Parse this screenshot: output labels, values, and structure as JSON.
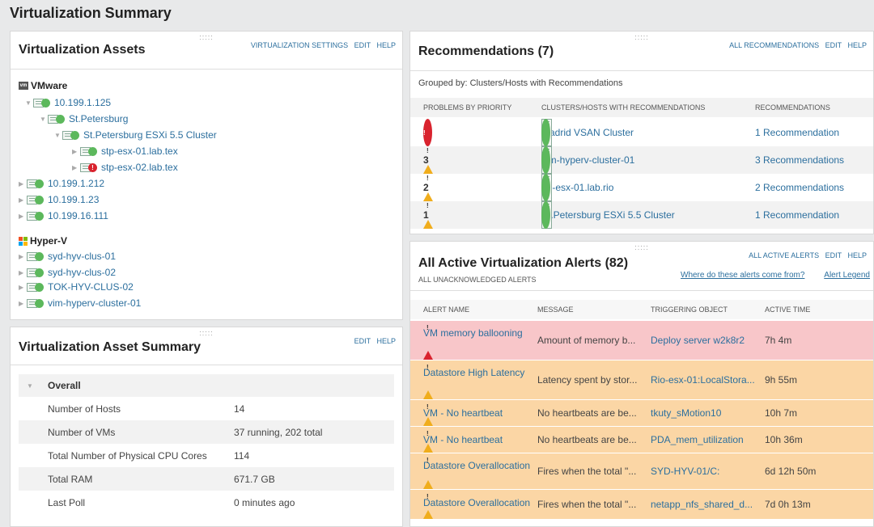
{
  "page_title": "Virtualization Summary",
  "grip": ":::::",
  "assets": {
    "title": "Virtualization Assets",
    "links": [
      "VIRTUALIZATION SETTINGS",
      "EDIT",
      "HELP"
    ],
    "vmware_label": "VMware",
    "hyperv_label": "Hyper-V",
    "vmware_tree": [
      {
        "label": "10.199.1.125",
        "status": "green"
      },
      {
        "label": "St.Petersburg",
        "status": "green"
      },
      {
        "label": "St.Petersburg ESXi 5.5 Cluster",
        "status": "green"
      },
      {
        "label": "stp-esx-01.lab.tex",
        "status": "green"
      },
      {
        "label": "stp-esx-02.lab.tex",
        "status": "red"
      },
      {
        "label": "10.199.1.212",
        "status": "green"
      },
      {
        "label": "10.199.1.23",
        "status": "green"
      },
      {
        "label": "10.199.16.111",
        "status": "green"
      }
    ],
    "hyperv_tree": [
      {
        "label": "syd-hyv-clus-01",
        "status": "green"
      },
      {
        "label": "syd-hyv-clus-02",
        "status": "green"
      },
      {
        "label": "TOK-HYV-CLUS-02",
        "status": "green"
      },
      {
        "label": "vim-hyperv-cluster-01",
        "status": "green"
      }
    ]
  },
  "asset_summary": {
    "title": "Virtualization Asset Summary",
    "links": [
      "EDIT",
      "HELP"
    ],
    "group": "Overall",
    "rows": [
      {
        "k": "Number of Hosts",
        "v": "14"
      },
      {
        "k": "Number of VMs",
        "v": "37 running, 202 total"
      },
      {
        "k": "Total Number of Physical CPU Cores",
        "v": "114"
      },
      {
        "k": "Total RAM",
        "v": "671.7 GB"
      },
      {
        "k": "Last Poll",
        "v": "0 minutes ago"
      }
    ]
  },
  "recommendations": {
    "title": "Recommendations (7)",
    "links": [
      "ALL RECOMMENDATIONS",
      "EDIT",
      "HELP"
    ],
    "grouped_by": "Grouped by: Clusters/Hosts with Recommendations",
    "columns": [
      "PROBLEMS BY PRIORITY",
      "CLUSTERS/HOSTS WITH RECOMMENDATIONS",
      "RECOMMENDATIONS"
    ],
    "rows": [
      {
        "severity": "critical",
        "count": "1",
        "target": "Madrid VSAN Cluster",
        "rec": "1 Recommendation"
      },
      {
        "severity": "warning",
        "count": "3",
        "target": "vim-hyperv-cluster-01",
        "rec": "3 Recommendations"
      },
      {
        "severity": "warning",
        "count": "2",
        "target": "rio-esx-01.lab.rio",
        "rec": "2 Recommendations"
      },
      {
        "severity": "warning",
        "count": "1",
        "target": "St.Petersburg ESXi 5.5 Cluster",
        "rec": "1 Recommendation"
      }
    ]
  },
  "alerts": {
    "title": "All Active Virtualization Alerts (82)",
    "subtitle": "ALL UNACKNOWLEDGED ALERTS",
    "links": [
      "ALL ACTIVE ALERTS",
      "EDIT",
      "HELP"
    ],
    "where_link": "Where do these alerts come from?",
    "legend_link": "Alert Legend",
    "columns": [
      "ALERT NAME",
      "MESSAGE",
      "TRIGGERING OBJECT",
      "ACTIVE TIME"
    ],
    "rows": [
      {
        "severity": "critical",
        "name": "VM memory ballooning",
        "message": "Amount of memory b...",
        "object": "Deploy server w2k8r2",
        "time": "7h 4m"
      },
      {
        "severity": "warning",
        "name": "Datastore High Latency",
        "message": "Latency spent by stor...",
        "object": "Rio-esx-01:LocalStora...",
        "time": "9h 55m"
      },
      {
        "severity": "warning",
        "name": "VM - No heartbeat",
        "message": "No heartbeats are be...",
        "object": "tkuty_sMotion10",
        "time": "10h 7m"
      },
      {
        "severity": "warning",
        "name": "VM - No heartbeat",
        "message": "No heartbeats are be...",
        "object": "PDA_mem_utilization",
        "time": "10h 36m"
      },
      {
        "severity": "warning",
        "name": "Datastore Overallocation",
        "message": "Fires when the total \"...",
        "object": "SYD-HYV-01/C:",
        "time": "6d 12h 50m"
      },
      {
        "severity": "warning",
        "name": "Datastore Overallocation",
        "message": "Fires when the total \"...",
        "object": "netapp_nfs_shared_d...",
        "time": "7d 0h 13m"
      }
    ]
  },
  "colors": {
    "link": "#2c6f9e",
    "ok": "#5cb85c",
    "critical": "#d9232e",
    "warning": "#f0ad1c",
    "alert_red_bg": "#f8c6c9",
    "alert_orange_bg": "#fbd6a5"
  }
}
